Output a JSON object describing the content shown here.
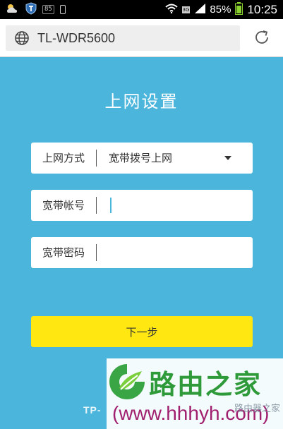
{
  "status_bar": {
    "notif_badge": "85",
    "battery_percent": "85%",
    "network_type": "3G",
    "clock": "10:25"
  },
  "browser": {
    "url": "TL-WDR5600"
  },
  "form": {
    "title": "上网设置",
    "connection_label": "上网方式",
    "connection_value": "宽带拨号上网",
    "account_label": "宽带帐号",
    "account_value": "",
    "password_label": "宽带密码",
    "password_value": "",
    "next_label": "下一步"
  },
  "footer": {
    "brand_partial": "TP-"
  },
  "watermark": {
    "cn_name": "路由之家",
    "url": "(www.hhhyh.com)",
    "small_text": "路由器之家"
  },
  "colors": {
    "page_bg": "#4bb5dc",
    "next_button": "#ffe812",
    "watermark_green": "#2f9a3a",
    "watermark_magenta": "#a01f6e"
  }
}
